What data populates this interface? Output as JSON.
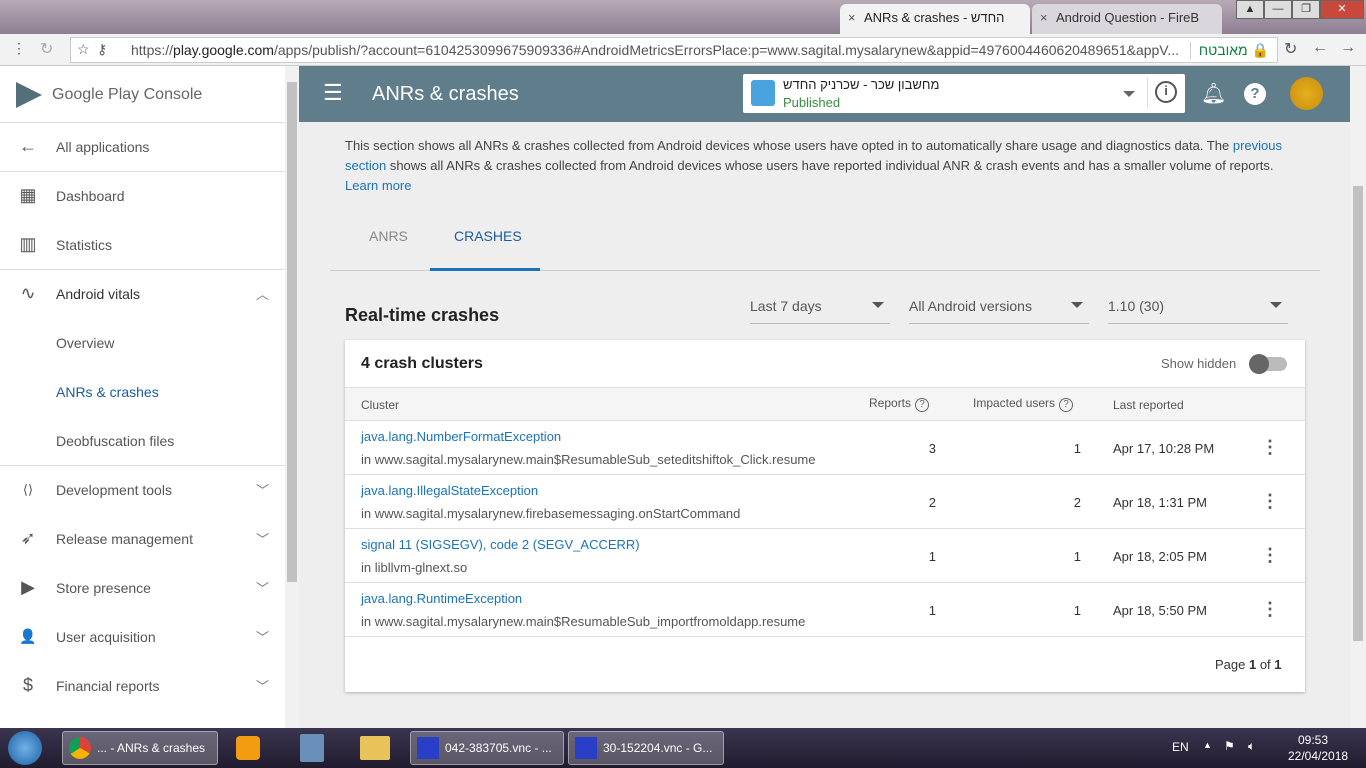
{
  "browser": {
    "tabs": [
      {
        "label": "ANRs & crashes - החדש",
        "close": "×"
      },
      {
        "label": "Android Question - FireB",
        "close": "×"
      }
    ],
    "url_prefix": "https://",
    "url_host": "play.google.com",
    "url_rest": "/apps/publish/?account=6104253099675909336#AndroidMetricsErrorsPlace:p=www.sagital.mysalarynew&appid=4976004460620489651&appV...",
    "secure_label": "מאובטח",
    "window_buttons": [
      "▲",
      "—",
      "❐",
      "✕"
    ]
  },
  "sidebar": {
    "logo": "Google Play Console",
    "items": [
      {
        "label": "All applications",
        "icon": "←"
      },
      {
        "label": "Dashboard",
        "icon": "▦"
      },
      {
        "label": "Statistics",
        "icon": "▥"
      },
      {
        "label": "Android vitals",
        "icon": "∿"
      },
      {
        "label": "Overview"
      },
      {
        "label": "ANRs & crashes"
      },
      {
        "label": "Deobfuscation files"
      },
      {
        "label": "Development tools",
        "icon": "⟨⟩"
      },
      {
        "label": "Release management",
        "icon": "➶"
      },
      {
        "label": "Store presence",
        "icon": "▶"
      },
      {
        "label": "User acquisition",
        "icon": "👤"
      },
      {
        "label": "Financial reports",
        "icon": "$"
      }
    ]
  },
  "header": {
    "title": "ANRs & crashes",
    "app_name": "מחשבון שכר - שכרניק החדש",
    "app_status": "Published"
  },
  "main": {
    "intro_1": "This section shows all ANRs & crashes collected from Android devices whose users have opted in to automatically share usage and diagnostics data. The ",
    "intro_link": "previous section",
    "intro_2": " shows all ANRs & crashes collected from Android devices whose users have reported individual ANR & crash events and has a smaller volume of reports.",
    "learn_more": "Learn more",
    "tabs": [
      "ANRS",
      "CRASHES"
    ],
    "section_title": "Real-time crashes",
    "filters": [
      "Last 7 days",
      "All Android versions",
      "1.10 (30)"
    ],
    "card_title": "4 crash clusters",
    "show_hidden": "Show hidden",
    "columns": [
      "Cluster",
      "Reports",
      "Impacted users",
      "Last reported"
    ],
    "rows": [
      {
        "title": "java.lang.NumberFormatException",
        "sub": "in www.sagital.mysalarynew.main$ResumableSub_seteditshiftok_Click.resume",
        "reports": "3",
        "users": "1",
        "last": "Apr 17, 10:28 PM"
      },
      {
        "title": "java.lang.IllegalStateException",
        "sub": "in www.sagital.mysalarynew.firebasemessaging.onStartCommand",
        "reports": "2",
        "users": "2",
        "last": "Apr 18, 1:31 PM"
      },
      {
        "title": "signal 11 (SIGSEGV), code 2 (SEGV_ACCERR)",
        "sub": "in libllvm-glnext.so",
        "reports": "1",
        "users": "1",
        "last": "Apr 18, 2:05 PM"
      },
      {
        "title": "java.lang.RuntimeException",
        "sub": "in www.sagital.mysalarynew.main$ResumableSub_importfromoldapp.resume",
        "reports": "1",
        "users": "1",
        "last": "Apr 18, 5:50 PM"
      }
    ],
    "page_prefix": "Page ",
    "page_current": "1",
    "page_of": " of ",
    "page_total": "1"
  },
  "taskbar": {
    "items": [
      "... - ANRs & crashes",
      "042-383705.vnc - ...",
      "30-152204.vnc - G..."
    ],
    "lang": "EN",
    "time": "09:53",
    "date": "22/04/2018"
  }
}
